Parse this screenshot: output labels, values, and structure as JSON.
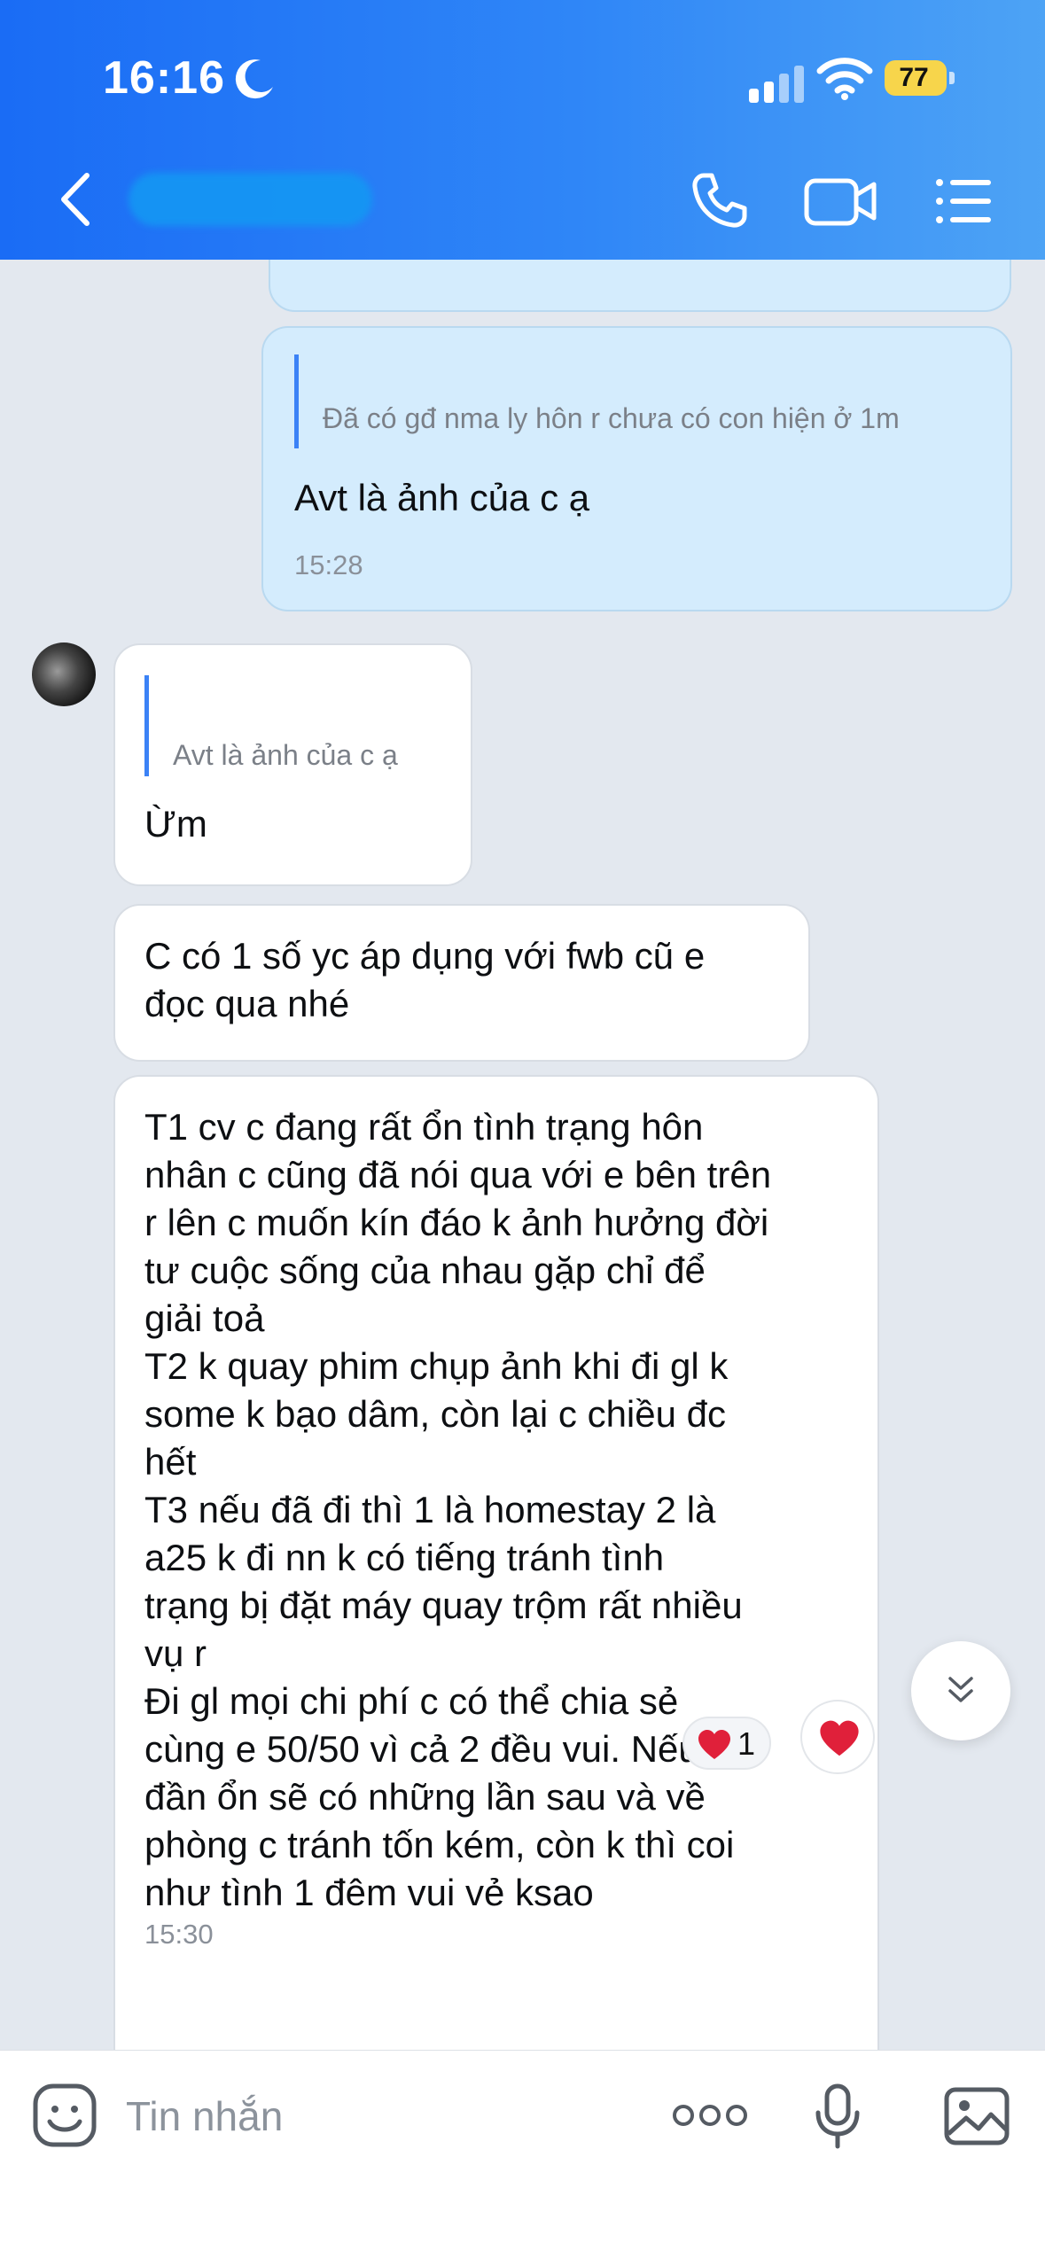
{
  "status_bar": {
    "time": "16:16",
    "battery": "77"
  },
  "header": {
    "contact_name": ""
  },
  "messages": [
    {
      "id": "m0",
      "direction": "out",
      "text": ""
    },
    {
      "id": "m1",
      "direction": "out",
      "quote": {
        "author": "",
        "text": "Đã có gđ nma ly hôn r chưa có con hiện ở 1m"
      },
      "text": "Avt là ảnh của c ạ",
      "time": "15:28"
    },
    {
      "id": "m2",
      "direction": "in",
      "quote": {
        "author": "",
        "text": "Avt là ảnh của c ạ"
      },
      "text": "Ừm"
    },
    {
      "id": "m3",
      "direction": "in",
      "lines": [
        "C có 1 số yc áp dụng với fwb cũ e",
        "đọc qua nhé"
      ]
    },
    {
      "id": "m4",
      "direction": "in",
      "lines": [
        "T1 cv c đang rất ổn tình trạng hôn",
        "nhân c cũng đã nói qua với e bên trên",
        "r lên c muốn kín đáo k ảnh hưởng đời",
        "tư cuộc sống của nhau gặp chỉ để",
        "giải toả",
        "T2 k quay phim chụp ảnh khi đi gl k",
        "some k bạo dâm, còn lại c chiều đc",
        "hết",
        "T3 nếu đã đi thì 1 là homestay 2 là",
        "a25 k đi nn k có tiếng tránh tình",
        "trạng bị đặt máy quay trộm rất nhiều",
        "vụ r",
        "Đi gl mọi chi phí c có thể chia sẻ",
        "cùng e 50/50 vì cả 2 đều vui. Nếu lần",
        "đần ổn sẽ có những lần sau và về",
        "phòng c tránh tốn kém, còn k thì coi",
        "như tình 1 đêm vui vẻ ksao"
      ],
      "time": "15:30",
      "reaction": {
        "emoji": "heart",
        "count": "1"
      }
    }
  ],
  "input": {
    "placeholder": "Tin nhắn"
  },
  "icons": [
    "moon-icon",
    "signal-icon",
    "wifi-icon",
    "battery-icon",
    "back-icon",
    "phone-icon",
    "video-icon",
    "menu-icon",
    "heart-icon",
    "chevron-double-down-icon",
    "emoji-icon",
    "more-dots-icon",
    "microphone-icon",
    "image-icon"
  ],
  "colors": {
    "header": "#2f86f7",
    "outgoing_bubble": "#d4ecfd",
    "incoming_bubble": "#ffffff",
    "chat_bg": "#e3e8ef",
    "quote_bar": "#3b82f6",
    "heart": "#e0203a"
  }
}
